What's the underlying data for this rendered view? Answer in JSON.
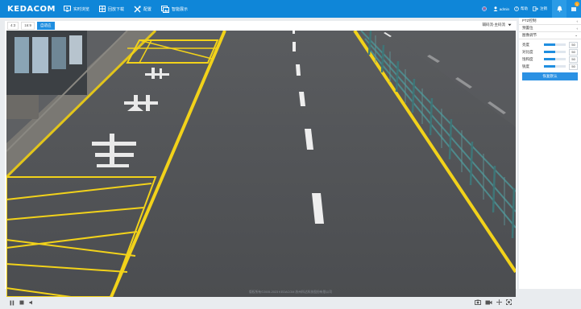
{
  "brand": "KEDACOM",
  "nav": [
    {
      "label": "实时浏览",
      "icon": "monitor-icon"
    },
    {
      "label": "回放下载",
      "icon": "film-icon"
    },
    {
      "label": "配置",
      "icon": "tools-icon"
    },
    {
      "label": "智能展示",
      "icon": "images-icon"
    }
  ],
  "header_right": {
    "user": "admin",
    "help": "帮助",
    "logout": "注销",
    "badge_count": "1"
  },
  "player": {
    "ratios": [
      "4:3",
      "16:9",
      "自适应"
    ],
    "active_ratio_index": 2,
    "stream": "辅码流-主码流"
  },
  "side": {
    "sections": [
      "PTZ控制",
      "预置位",
      "图像调节"
    ],
    "sliders": [
      {
        "label": "亮度",
        "value": 50
      },
      {
        "label": "对比度",
        "value": 50
      },
      {
        "label": "饱和度",
        "value": 50
      },
      {
        "label": "锐度",
        "value": 50
      }
    ],
    "reset_label": "恢复默认"
  },
  "footer": "版权所有©2005-2023 KEDACOM 苏州科达科技股份有限公司",
  "colors": {
    "primary": "#0f86d8",
    "accent": "#1f8ee0",
    "road": "#4a4c4f",
    "lane_yellow": "#f2d21a"
  }
}
